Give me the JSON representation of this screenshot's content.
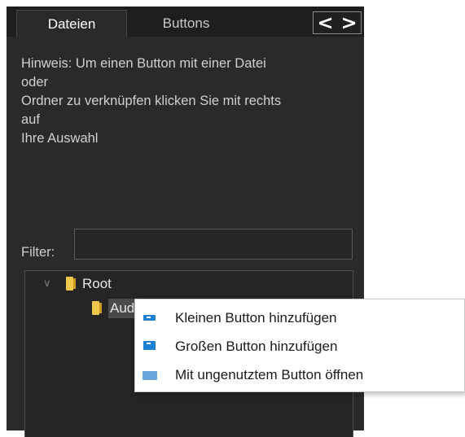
{
  "tabs": [
    {
      "label": "Dateien",
      "active": true
    },
    {
      "label": "Buttons",
      "active": false
    }
  ],
  "nav": {
    "prev": "<",
    "next": ">"
  },
  "hint": {
    "lines": [
      "Hinweis: Um einen Button mit einer Datei",
      "oder",
      "Ordner zu verknüpfen klicken Sie mit rechts",
      "auf",
      "Ihre Auswahl"
    ]
  },
  "filter": {
    "label": "Filter:",
    "value": ""
  },
  "tree": {
    "root_label": "Root",
    "child_label": "Aud"
  },
  "context_menu": {
    "items": [
      {
        "label": "Kleinen Button hinzufügen",
        "icon": "small-button-icon"
      },
      {
        "label": "Großen Button hinzufügen",
        "icon": "large-button-icon"
      },
      {
        "label": "Mit ungenutztem Button öffnen",
        "icon": "unused-button-icon"
      }
    ]
  },
  "colors": {
    "panel_bg": "#2a2a2a",
    "folder": "#f2c84b",
    "menu_icon": "#1e7fd6"
  }
}
